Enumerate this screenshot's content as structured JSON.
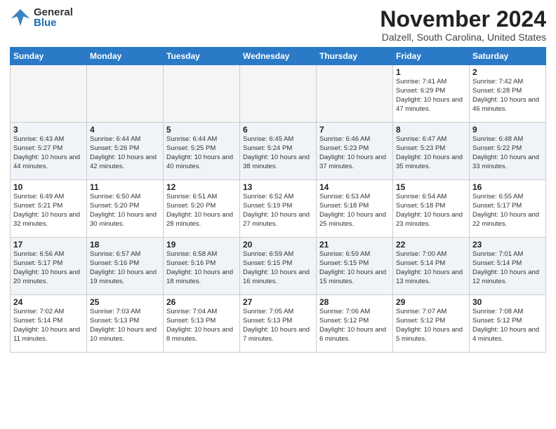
{
  "header": {
    "logo_general": "General",
    "logo_blue": "Blue",
    "month_title": "November 2024",
    "location": "Dalzell, South Carolina, United States"
  },
  "calendar": {
    "headers": [
      "Sunday",
      "Monday",
      "Tuesday",
      "Wednesday",
      "Thursday",
      "Friday",
      "Saturday"
    ],
    "weeks": [
      [
        {
          "day": "",
          "empty": true
        },
        {
          "day": "",
          "empty": true
        },
        {
          "day": "",
          "empty": true
        },
        {
          "day": "",
          "empty": true
        },
        {
          "day": "",
          "empty": true
        },
        {
          "day": "1",
          "sunrise": "Sunrise: 7:41 AM",
          "sunset": "Sunset: 6:29 PM",
          "daylight": "Daylight: 10 hours and 47 minutes."
        },
        {
          "day": "2",
          "sunrise": "Sunrise: 7:42 AM",
          "sunset": "Sunset: 6:28 PM",
          "daylight": "Daylight: 10 hours and 46 minutes."
        }
      ],
      [
        {
          "day": "3",
          "sunrise": "Sunrise: 6:43 AM",
          "sunset": "Sunset: 5:27 PM",
          "daylight": "Daylight: 10 hours and 44 minutes."
        },
        {
          "day": "4",
          "sunrise": "Sunrise: 6:44 AM",
          "sunset": "Sunset: 5:26 PM",
          "daylight": "Daylight: 10 hours and 42 minutes."
        },
        {
          "day": "5",
          "sunrise": "Sunrise: 6:44 AM",
          "sunset": "Sunset: 5:25 PM",
          "daylight": "Daylight: 10 hours and 40 minutes."
        },
        {
          "day": "6",
          "sunrise": "Sunrise: 6:45 AM",
          "sunset": "Sunset: 5:24 PM",
          "daylight": "Daylight: 10 hours and 38 minutes."
        },
        {
          "day": "7",
          "sunrise": "Sunrise: 6:46 AM",
          "sunset": "Sunset: 5:23 PM",
          "daylight": "Daylight: 10 hours and 37 minutes."
        },
        {
          "day": "8",
          "sunrise": "Sunrise: 6:47 AM",
          "sunset": "Sunset: 5:23 PM",
          "daylight": "Daylight: 10 hours and 35 minutes."
        },
        {
          "day": "9",
          "sunrise": "Sunrise: 6:48 AM",
          "sunset": "Sunset: 5:22 PM",
          "daylight": "Daylight: 10 hours and 33 minutes."
        }
      ],
      [
        {
          "day": "10",
          "sunrise": "Sunrise: 6:49 AM",
          "sunset": "Sunset: 5:21 PM",
          "daylight": "Daylight: 10 hours and 32 minutes."
        },
        {
          "day": "11",
          "sunrise": "Sunrise: 6:50 AM",
          "sunset": "Sunset: 5:20 PM",
          "daylight": "Daylight: 10 hours and 30 minutes."
        },
        {
          "day": "12",
          "sunrise": "Sunrise: 6:51 AM",
          "sunset": "Sunset: 5:20 PM",
          "daylight": "Daylight: 10 hours and 28 minutes."
        },
        {
          "day": "13",
          "sunrise": "Sunrise: 6:52 AM",
          "sunset": "Sunset: 5:19 PM",
          "daylight": "Daylight: 10 hours and 27 minutes."
        },
        {
          "day": "14",
          "sunrise": "Sunrise: 6:53 AM",
          "sunset": "Sunset: 5:18 PM",
          "daylight": "Daylight: 10 hours and 25 minutes."
        },
        {
          "day": "15",
          "sunrise": "Sunrise: 6:54 AM",
          "sunset": "Sunset: 5:18 PM",
          "daylight": "Daylight: 10 hours and 23 minutes."
        },
        {
          "day": "16",
          "sunrise": "Sunrise: 6:55 AM",
          "sunset": "Sunset: 5:17 PM",
          "daylight": "Daylight: 10 hours and 22 minutes."
        }
      ],
      [
        {
          "day": "17",
          "sunrise": "Sunrise: 6:56 AM",
          "sunset": "Sunset: 5:17 PM",
          "daylight": "Daylight: 10 hours and 20 minutes."
        },
        {
          "day": "18",
          "sunrise": "Sunrise: 6:57 AM",
          "sunset": "Sunset: 5:16 PM",
          "daylight": "Daylight: 10 hours and 19 minutes."
        },
        {
          "day": "19",
          "sunrise": "Sunrise: 6:58 AM",
          "sunset": "Sunset: 5:16 PM",
          "daylight": "Daylight: 10 hours and 18 minutes."
        },
        {
          "day": "20",
          "sunrise": "Sunrise: 6:59 AM",
          "sunset": "Sunset: 5:15 PM",
          "daylight": "Daylight: 10 hours and 16 minutes."
        },
        {
          "day": "21",
          "sunrise": "Sunrise: 6:59 AM",
          "sunset": "Sunset: 5:15 PM",
          "daylight": "Daylight: 10 hours and 15 minutes."
        },
        {
          "day": "22",
          "sunrise": "Sunrise: 7:00 AM",
          "sunset": "Sunset: 5:14 PM",
          "daylight": "Daylight: 10 hours and 13 minutes."
        },
        {
          "day": "23",
          "sunrise": "Sunrise: 7:01 AM",
          "sunset": "Sunset: 5:14 PM",
          "daylight": "Daylight: 10 hours and 12 minutes."
        }
      ],
      [
        {
          "day": "24",
          "sunrise": "Sunrise: 7:02 AM",
          "sunset": "Sunset: 5:14 PM",
          "daylight": "Daylight: 10 hours and 11 minutes."
        },
        {
          "day": "25",
          "sunrise": "Sunrise: 7:03 AM",
          "sunset": "Sunset: 5:13 PM",
          "daylight": "Daylight: 10 hours and 10 minutes."
        },
        {
          "day": "26",
          "sunrise": "Sunrise: 7:04 AM",
          "sunset": "Sunset: 5:13 PM",
          "daylight": "Daylight: 10 hours and 8 minutes."
        },
        {
          "day": "27",
          "sunrise": "Sunrise: 7:05 AM",
          "sunset": "Sunset: 5:13 PM",
          "daylight": "Daylight: 10 hours and 7 minutes."
        },
        {
          "day": "28",
          "sunrise": "Sunrise: 7:06 AM",
          "sunset": "Sunset: 5:12 PM",
          "daylight": "Daylight: 10 hours and 6 minutes."
        },
        {
          "day": "29",
          "sunrise": "Sunrise: 7:07 AM",
          "sunset": "Sunset: 5:12 PM",
          "daylight": "Daylight: 10 hours and 5 minutes."
        },
        {
          "day": "30",
          "sunrise": "Sunrise: 7:08 AM",
          "sunset": "Sunset: 5:12 PM",
          "daylight": "Daylight: 10 hours and 4 minutes."
        }
      ]
    ]
  }
}
